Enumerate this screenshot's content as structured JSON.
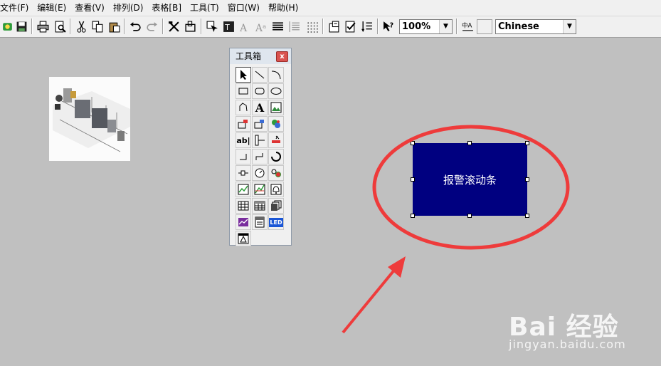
{
  "menu": {
    "items": [
      "文件(F)",
      "编辑(E)",
      "查看(V)",
      "排列(D)",
      "表格[B]",
      "工具(T)",
      "窗口(W)",
      "帮助(H)"
    ]
  },
  "toolbar": {
    "zoom_value": "100%",
    "language_value": "Chinese",
    "language_icon_text": "中A",
    "icons": [
      "new-icon",
      "save-icon",
      "print-icon",
      "print-preview-icon",
      "cut-icon",
      "copy-icon",
      "paste-icon",
      "undo-icon",
      "redo-icon",
      "tools-icon",
      "frame-icon",
      "select-object-icon",
      "text-style-icon",
      "font-size-down-icon",
      "font-size-up-icon",
      "align-icon",
      "list-icon",
      "grid-dots-icon",
      "properties-icon",
      "check-icon",
      "sort-icon",
      "context-help-icon"
    ]
  },
  "toolbox": {
    "title": "工具箱",
    "close_label": "x",
    "text_tool": "A",
    "label_tool": "ab|",
    "led_tool": "LED"
  },
  "canvas": {
    "alarm_object_label": "报警滚动条"
  },
  "annotation": {
    "ellipse_color": "#ee3b3b",
    "arrow_color": "#ee3b3b"
  },
  "watermark": {
    "logo": "Bai 经验",
    "url": "jingyan.baidu.com"
  },
  "colors": {
    "object_fill": "#000080",
    "workspace": "#c0c0c0"
  }
}
